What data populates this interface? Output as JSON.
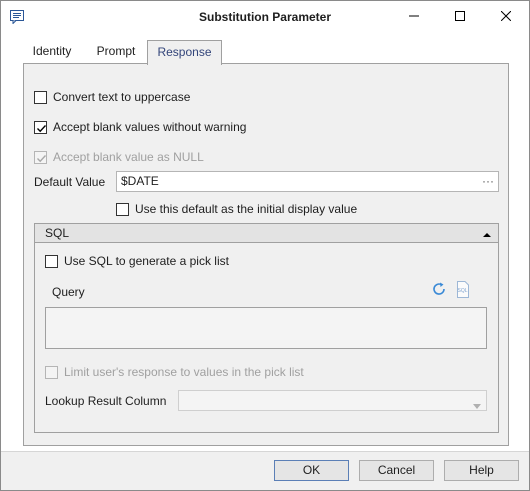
{
  "window": {
    "title": "Substitution Parameter"
  },
  "tabs": [
    {
      "label": "Identity"
    },
    {
      "label": "Prompt"
    },
    {
      "label": "Response"
    }
  ],
  "response": {
    "convert_uppercase": {
      "label": "Convert text to uppercase",
      "checked": false
    },
    "accept_blank": {
      "label": "Accept blank values without warning",
      "checked": true
    },
    "accept_null": {
      "label": "Accept blank value as NULL",
      "checked": true,
      "disabled": true
    },
    "default_value": {
      "label": "Default Value",
      "value": "$DATE",
      "browse_label": "···"
    },
    "use_default_initial": {
      "label": "Use this default as the initial display value",
      "checked": false
    },
    "sql_group": {
      "title": "SQL",
      "use_sql": {
        "label": "Use SQL to generate a pick list",
        "checked": false
      },
      "query_label": "Query",
      "query_value": "",
      "limit_response": {
        "label": "Limit user's response to values in the pick list",
        "checked": false,
        "disabled": true
      },
      "lookup_label": "Lookup Result Column",
      "lookup_value": ""
    }
  },
  "buttons": {
    "ok": "OK",
    "cancel": "Cancel",
    "help": "Help"
  },
  "colors": {
    "accent": "#3b8ad6",
    "active_tab_text": "#33457a",
    "disabled_text": "#a0a0a0"
  }
}
